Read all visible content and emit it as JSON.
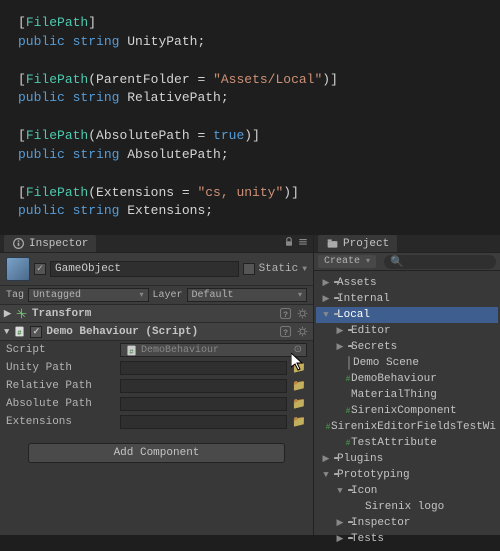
{
  "code": {
    "l1a": "[",
    "l1b": "FilePath",
    "l1c": "]",
    "l2a": "public",
    "l2b": "string",
    "l2c": " UnityPath;",
    "l3a": "[",
    "l3b": "FilePath",
    "l3c": "(ParentFolder = ",
    "l3d": "\"Assets/Local\"",
    "l3e": ")]",
    "l4a": "public",
    "l4b": "string",
    "l4c": " RelativePath;",
    "l5a": "[",
    "l5b": "FilePath",
    "l5c": "(AbsolutePath = ",
    "l5d": "true",
    "l5e": ")]",
    "l6a": "public",
    "l6b": "string",
    "l6c": " AbsolutePath;",
    "l7a": "[",
    "l7b": "FilePath",
    "l7c": "(Extensions = ",
    "l7d": "\"cs, unity\"",
    "l7e": ")]",
    "l8a": "public",
    "l8b": "string",
    "l8c": " Extensions;"
  },
  "inspector": {
    "tab": "Inspector",
    "go_name": "GameObject",
    "static_label": "Static",
    "tag_label": "Tag",
    "tag_value": "Untagged",
    "layer_label": "Layer",
    "layer_value": "Default",
    "transform_title": "Transform",
    "demo_title": "Demo Behaviour (Script)",
    "fields": {
      "script_label": "Script",
      "script_value": "DemoBehaviour",
      "unity_path_label": "Unity Path",
      "relative_path_label": "Relative Path",
      "absolute_path_label": "Absolute Path",
      "extensions_label": "Extensions"
    },
    "add_component": "Add Component"
  },
  "project": {
    "tab": "Project",
    "create": "Create",
    "tree": [
      {
        "depth": 0,
        "fold": "▶",
        "icon": "folder",
        "label": "Assets"
      },
      {
        "depth": 0,
        "fold": "▶",
        "icon": "folder",
        "label": "Internal"
      },
      {
        "depth": 0,
        "fold": "▼",
        "icon": "folder",
        "label": "Local",
        "sel": true
      },
      {
        "depth": 1,
        "fold": "▶",
        "icon": "folder",
        "label": "Editor"
      },
      {
        "depth": 1,
        "fold": "▶",
        "icon": "folder",
        "label": "Secrets"
      },
      {
        "depth": 1,
        "fold": "",
        "icon": "scene",
        "label": "Demo Scene"
      },
      {
        "depth": 1,
        "fold": "",
        "icon": "script",
        "label": "DemoBehaviour"
      },
      {
        "depth": 1,
        "fold": "",
        "icon": "mat",
        "label": "MaterialThing"
      },
      {
        "depth": 1,
        "fold": "",
        "icon": "script",
        "label": "SirenixComponent"
      },
      {
        "depth": 1,
        "fold": "",
        "icon": "script",
        "label": "SirenixEditorFieldsTestWi"
      },
      {
        "depth": 1,
        "fold": "",
        "icon": "script",
        "label": "TestAttribute"
      },
      {
        "depth": 0,
        "fold": "▶",
        "icon": "folder",
        "label": "Plugins"
      },
      {
        "depth": 0,
        "fold": "▼",
        "icon": "folder",
        "label": "Prototyping"
      },
      {
        "depth": 1,
        "fold": "▼",
        "icon": "folder",
        "label": "Icon"
      },
      {
        "depth": 2,
        "fold": "",
        "icon": "img",
        "label": "Sirenix logo"
      },
      {
        "depth": 1,
        "fold": "▶",
        "icon": "folder",
        "label": "Inspector"
      },
      {
        "depth": 1,
        "fold": "▶",
        "icon": "folder",
        "label": "Tests"
      }
    ]
  }
}
